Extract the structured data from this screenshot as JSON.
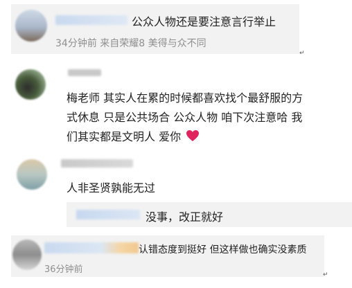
{
  "comments": [
    {
      "text": "公众人物还是要注意言行举止",
      "meta": "34分钟前 来自荣耀8 美得与众不同"
    },
    {
      "lines": [
        "梅老师 其实人在累的时候都喜欢找个最舒服的方",
        "式休息 只是公共场合 公众人物 咱下次注意哈 我",
        "们其实都是文明人 爱你"
      ],
      "emoji": "heart-emoji"
    },
    {
      "text": "人非圣贤孰能无过",
      "reply": "没事，改正就好"
    },
    {
      "text": "认错态度到挺好 但这样做也确实没素质",
      "meta": "36分钟前"
    }
  ],
  "colors": {
    "card_bg": "#f2f2f2",
    "meta": "#8f8f8f",
    "heart": "#e0245e"
  }
}
